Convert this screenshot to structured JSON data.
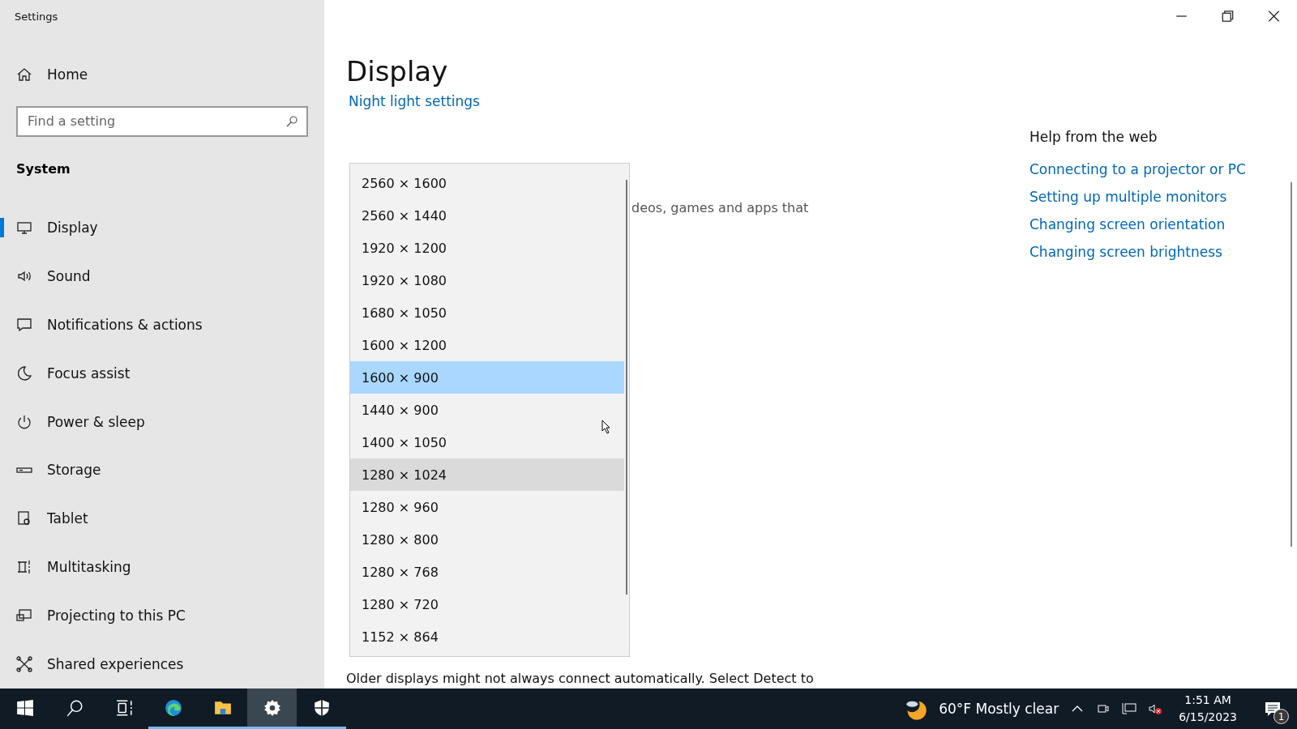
{
  "window": {
    "title": "Settings"
  },
  "sidebar": {
    "home": "Home",
    "search": {
      "placeholder": "Find a setting"
    },
    "section": "System",
    "items": [
      {
        "label": "Display",
        "kind": "monitor",
        "selected": true
      },
      {
        "label": "Sound",
        "kind": "speaker",
        "selected": false
      },
      {
        "label": "Notifications & actions",
        "kind": "message",
        "selected": false
      },
      {
        "label": "Focus assist",
        "kind": "moon",
        "selected": false
      },
      {
        "label": "Power & sleep",
        "kind": "power",
        "selected": false
      },
      {
        "label": "Storage",
        "kind": "drive",
        "selected": false
      },
      {
        "label": "Tablet",
        "kind": "tablet",
        "selected": false
      },
      {
        "label": "Multitasking",
        "kind": "multitask",
        "selected": false
      },
      {
        "label": "Projecting to this PC",
        "kind": "project",
        "selected": false
      },
      {
        "label": "Shared experiences",
        "kind": "share",
        "selected": false
      }
    ]
  },
  "main": {
    "title": "Display",
    "link": "Night light settings",
    "partial_text": "deos, games and apps that",
    "bottom_text": "Older displays might not always connect automatically. Select Detect to"
  },
  "dropdown": {
    "options": [
      {
        "label": "2560 × 1600",
        "selected": false,
        "hovered": false
      },
      {
        "label": "2560 × 1440",
        "selected": false,
        "hovered": false
      },
      {
        "label": "1920 × 1200",
        "selected": false,
        "hovered": false
      },
      {
        "label": "1920 × 1080",
        "selected": false,
        "hovered": false
      },
      {
        "label": "1680 × 1050",
        "selected": false,
        "hovered": false
      },
      {
        "label": "1600 × 1200",
        "selected": false,
        "hovered": false
      },
      {
        "label": "1600 × 900",
        "selected": true,
        "hovered": false
      },
      {
        "label": "1440 × 900",
        "selected": false,
        "hovered": false
      },
      {
        "label": "1400 × 1050",
        "selected": false,
        "hovered": false
      },
      {
        "label": "1280 × 1024",
        "selected": false,
        "hovered": true
      },
      {
        "label": "1280 × 960",
        "selected": false,
        "hovered": false
      },
      {
        "label": "1280 × 800",
        "selected": false,
        "hovered": false
      },
      {
        "label": "1280 × 768",
        "selected": false,
        "hovered": false
      },
      {
        "label": "1280 × 720",
        "selected": false,
        "hovered": false
      },
      {
        "label": "1152 × 864",
        "selected": false,
        "hovered": false
      }
    ]
  },
  "help": {
    "title": "Help from the web",
    "links": [
      "Connecting to a projector or PC",
      "Setting up multiple monitors",
      "Changing screen orientation",
      "Changing screen brightness"
    ]
  },
  "taskbar": {
    "apps": [
      {
        "kind": "start",
        "running": false,
        "selected": false
      },
      {
        "kind": "search",
        "running": false,
        "selected": false
      },
      {
        "kind": "taskview",
        "running": false,
        "selected": false
      },
      {
        "kind": "edge",
        "running": true,
        "selected": false
      },
      {
        "kind": "explorer",
        "running": true,
        "selected": false
      },
      {
        "kind": "settings",
        "running": true,
        "selected": true
      },
      {
        "kind": "security",
        "running": true,
        "selected": false
      }
    ],
    "weather": "60°F  Mostly clear",
    "time": "1:51 AM",
    "date": "6/15/2023",
    "notifications": "1"
  }
}
